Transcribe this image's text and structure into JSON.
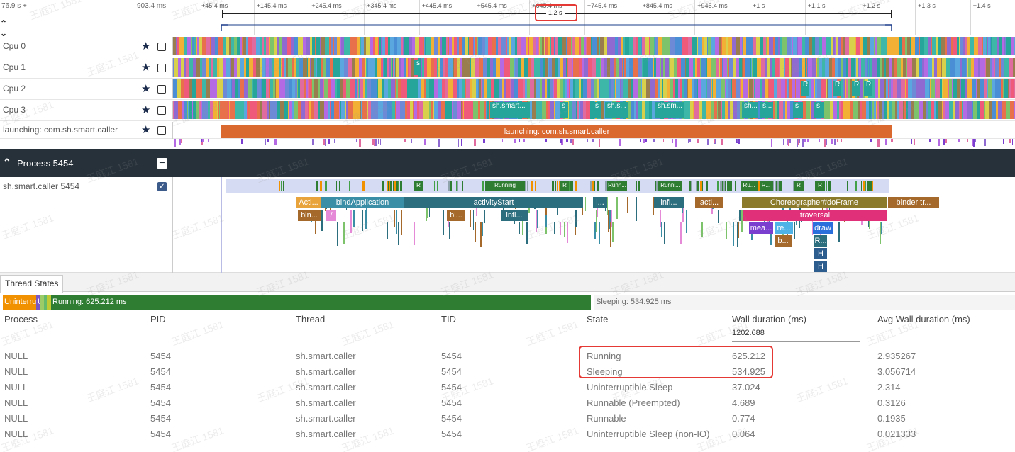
{
  "ruler": {
    "start_time": "76.9 s +",
    "visible_span": "903.4 ms",
    "ticks": [
      "+45.4 ms",
      "+145.4 ms",
      "+245.4 ms",
      "+345.4 ms",
      "+445.4 ms",
      "+545.4 ms",
      "+645.4 ms",
      "+745.4 ms",
      "+845.4 ms",
      "+945.4 ms",
      "+1 s",
      "+1.1 s",
      "+1.2 s",
      "+1.3 s",
      "+1.4 s"
    ],
    "selection_label": "1.2 s",
    "collapse_icon": "double-chevron"
  },
  "cpu_tracks": [
    {
      "label": "Cpu 0",
      "slices": []
    },
    {
      "label": "Cpu 1",
      "slices": [
        "s"
      ]
    },
    {
      "label": "Cpu 2",
      "slices": [
        "R",
        "R",
        "R",
        "R",
        "R"
      ]
    },
    {
      "label": "Cpu 3",
      "slices": [
        "sh.smart...",
        "s",
        "s",
        "sh.s...",
        "sh.sm...",
        "sh...",
        "s...",
        "s",
        "s"
      ]
    }
  ],
  "launch_track": {
    "label": "launching: com.sh.smart.caller",
    "bar_label": "launching: com.sh.smart.caller"
  },
  "process": {
    "title": "Process 5454",
    "thread_label": "sh.smart.caller 5454",
    "state_labels": [
      "R",
      "Running",
      "R",
      "Runn...",
      "Runni...",
      "Ru...",
      "R...",
      "R",
      "R"
    ],
    "slices": {
      "l1": [
        "Acti...",
        "bindApplication",
        "activityStart",
        "i...",
        "infl...",
        "acti...",
        "Choreographer#doFrame",
        "binder tr..."
      ],
      "l2": [
        "bin...",
        "/",
        "bi...",
        "traversal"
      ],
      "l3": [
        "infl...",
        "mea...",
        "re...",
        "draw"
      ],
      "l4": [
        "b...",
        "R..."
      ],
      "l5": [
        "H"
      ],
      "l6": [
        "H"
      ]
    }
  },
  "panel": {
    "tab": "Thread States",
    "summary": {
      "uninterruptible": "Uninterru",
      "small_u": "U",
      "running": "Running: 625.212 ms",
      "sleeping": "Sleeping: 534.925 ms"
    },
    "columns": [
      "Process",
      "PID",
      "Thread",
      "TID",
      "State",
      "Wall duration (ms)",
      "Avg Wall duration (ms)"
    ],
    "total_wall": "1202.688",
    "rows": [
      [
        "NULL",
        "5454",
        "sh.smart.caller",
        "5454",
        "Running",
        "625.212",
        "2.935267"
      ],
      [
        "NULL",
        "5454",
        "sh.smart.caller",
        "5454",
        "Sleeping",
        "534.925",
        "3.056714"
      ],
      [
        "NULL",
        "5454",
        "sh.smart.caller",
        "5454",
        "Uninterruptible Sleep",
        "37.024",
        "2.314"
      ],
      [
        "NULL",
        "5454",
        "sh.smart.caller",
        "5454",
        "Runnable (Preempted)",
        "4.689",
        "0.3126"
      ],
      [
        "NULL",
        "5454",
        "sh.smart.caller",
        "5454",
        "Runnable",
        "0.774",
        "0.1935"
      ],
      [
        "NULL",
        "5454",
        "sh.smart.caller",
        "5454",
        "Uninterruptible Sleep (non-IO)",
        "0.064",
        "0.021333"
      ]
    ]
  },
  "watermark": "王庭江 1581",
  "colors": {
    "running": "#2e7d32",
    "uninterruptible": "#f29100",
    "launch": "#d9692e",
    "process_header": "#27313a",
    "highlight": "#e53935",
    "slice_teal": "#26a69a",
    "slice_brown": "#a56a2b",
    "slice_pink": "#e0307a",
    "slice_blue": "#2a6fdb",
    "slice_dark_teal": "#2d6e7e",
    "slice_olive": "#8a7a2a"
  }
}
